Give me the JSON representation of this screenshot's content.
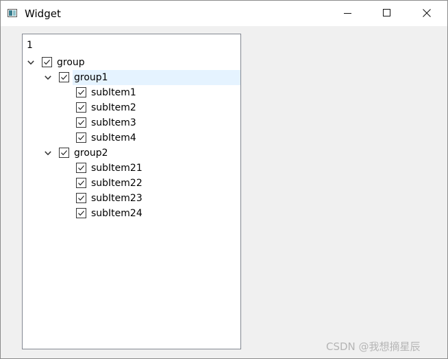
{
  "window": {
    "title": "Widget",
    "icon": "app-window-icon"
  },
  "tree": {
    "header": "1",
    "items": [
      {
        "label": "group",
        "level": 0,
        "expanded": true,
        "checked": true
      },
      {
        "label": "group1",
        "level": 1,
        "expanded": true,
        "checked": true,
        "selected": true
      },
      {
        "label": "subItem1",
        "level": 2,
        "checked": true
      },
      {
        "label": "subItem2",
        "level": 2,
        "checked": true
      },
      {
        "label": "subItem3",
        "level": 2,
        "checked": true
      },
      {
        "label": "subItem4",
        "level": 2,
        "checked": true
      },
      {
        "label": "group2",
        "level": 1,
        "expanded": true,
        "checked": true
      },
      {
        "label": "subItem21",
        "level": 2,
        "checked": true
      },
      {
        "label": "subItem22",
        "level": 2,
        "checked": true
      },
      {
        "label": "subItem23",
        "level": 2,
        "checked": true
      },
      {
        "label": "subItem24",
        "level": 2,
        "checked": true
      }
    ]
  },
  "watermark": "CSDN @我想摘星辰",
  "colors": {
    "selection": "#e5f3ff",
    "background": "#f0f0f0",
    "tree_background": "#ffffff"
  }
}
